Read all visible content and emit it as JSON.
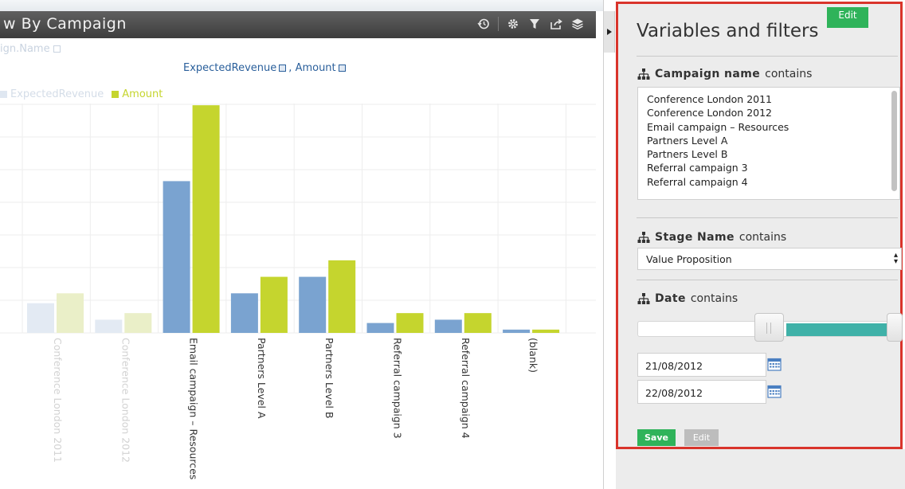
{
  "chart_panel": {
    "title": "w By Campaign",
    "dimension_label": "ign.Name",
    "measures_label_a": "ExpectedRevenue",
    "measures_label_sep": ",",
    "measures_label_b": "Amount"
  },
  "filters_panel": {
    "title": "Variables and filters",
    "edit_tag": "Edit",
    "contains_word": "contains",
    "campaign_filter": {
      "field": "Campaign name",
      "options": [
        "Conference London 2011",
        "Conference London 2012",
        "Email campaign – Resources",
        "Partners Level A",
        "Partners Level B",
        "Referral campaign 3",
        "Referral campaign 4"
      ]
    },
    "stage_filter": {
      "field": "Stage Name",
      "selected": "Value Proposition"
    },
    "date_filter": {
      "field": "Date",
      "from": "21/08/2012",
      "to": "22/08/2012",
      "range_fraction": [
        0.58,
        1.0
      ]
    },
    "save_label": "Save",
    "edit_label": "Edit"
  },
  "colors": {
    "expected_revenue": "#7aa3d0",
    "amount": "#c5d52e",
    "accent_green": "#2fb35a",
    "frame_red": "#d9342b",
    "slider_teal": "#3fb1a8"
  },
  "chart_data": {
    "type": "bar",
    "categories": [
      "Conference London 2011",
      "Conference London 2012",
      "Email campaign – Resources",
      "Partners Level A",
      "Partners Level B",
      "Referral campaign 3",
      "Referral campaign 4",
      "(blank)"
    ],
    "series": [
      {
        "name": "ExpectedRevenue",
        "color": "#7aa3d0",
        "values": [
          9,
          4,
          46,
          12,
          17,
          3,
          4,
          1
        ]
      },
      {
        "name": "Amount",
        "color": "#c5d52e",
        "values": [
          12,
          6,
          69,
          17,
          22,
          6,
          6,
          1
        ]
      }
    ],
    "ylim": [
      0,
      70
    ],
    "grid": true,
    "legend": "top-left",
    "faded_categories": [
      0,
      1
    ]
  }
}
